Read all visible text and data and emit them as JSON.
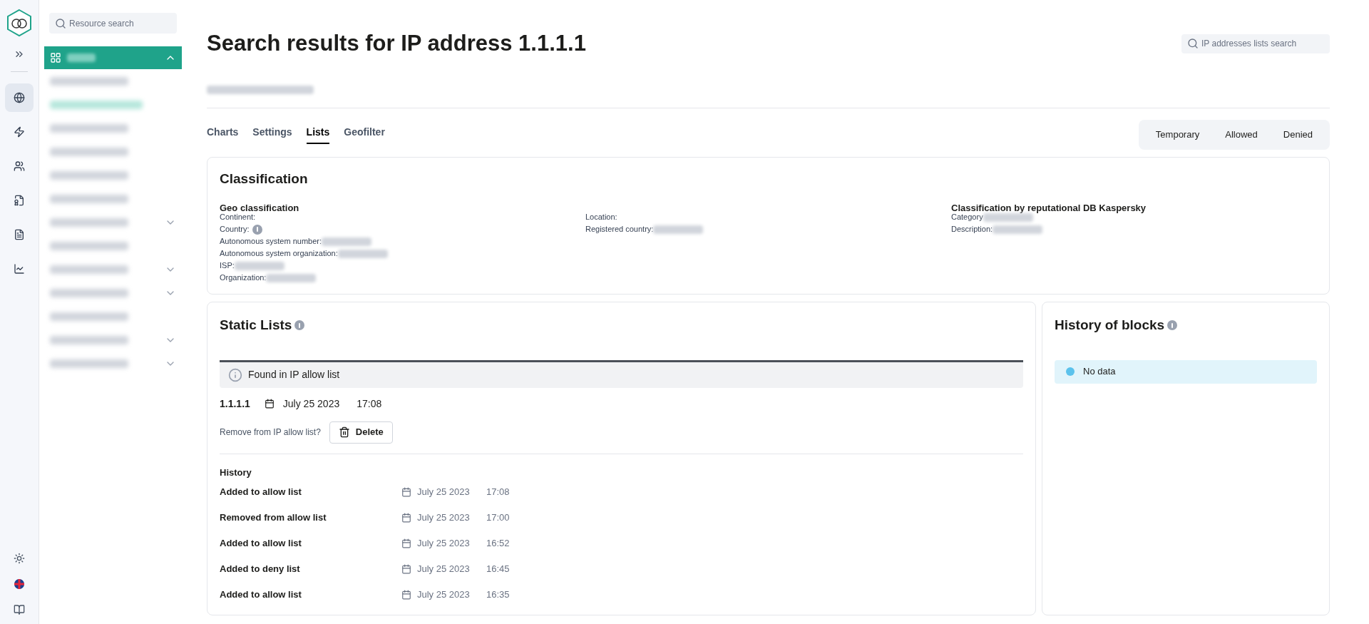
{
  "rail": {
    "items": [
      {
        "kind": "globe",
        "selected": true
      },
      {
        "kind": "zap",
        "selected": false
      },
      {
        "kind": "users",
        "selected": false
      },
      {
        "kind": "award",
        "selected": false
      },
      {
        "kind": "info",
        "selected": false
      },
      {
        "kind": "chart",
        "selected": false
      }
    ]
  },
  "sidebar": {
    "search": {
      "placeholder": "Resource search"
    },
    "items": [
      {
        "kind": "link",
        "selected": false
      },
      {
        "kind": "link",
        "selected": true
      },
      {
        "kind": "link",
        "selected": false
      },
      {
        "kind": "link",
        "selected": false
      },
      {
        "kind": "link",
        "selected": false
      },
      {
        "kind": "link",
        "selected": false
      },
      {
        "kind": "group",
        "selected": false
      },
      {
        "kind": "link",
        "selected": false
      },
      {
        "kind": "group",
        "selected": false
      },
      {
        "kind": "group",
        "selected": false
      },
      {
        "kind": "link",
        "selected": false
      },
      {
        "kind": "group",
        "selected": false
      },
      {
        "kind": "group",
        "selected": false
      }
    ]
  },
  "page": {
    "title": "Search results for IP address 1.1.1.1",
    "search": {
      "placeholder": "IP addresses lists search"
    }
  },
  "tabs": [
    {
      "label": "Charts",
      "selected": false
    },
    {
      "label": "Settings",
      "selected": false
    },
    {
      "label": "Lists",
      "selected": true
    },
    {
      "label": "Geofilter",
      "selected": false
    }
  ],
  "filters": [
    "Temporary",
    "Allowed",
    "Denied"
  ],
  "classification": {
    "title": "Classification",
    "columns": [
      {
        "heading": "Geo classification",
        "fields": [
          {
            "label": "Continent:",
            "redacted": false
          },
          {
            "label": "Country:",
            "info": true,
            "redacted": false
          },
          {
            "label": "Autonomous system number:",
            "redacted": true
          },
          {
            "label": "Autonomous system organization:",
            "redacted": true
          },
          {
            "label": "ISP:",
            "redacted": true
          },
          {
            "label": "Organization:",
            "redacted": true
          }
        ]
      },
      {
        "fields": [
          {
            "label": "Location:",
            "redacted": false
          },
          {
            "label": "Registered country:",
            "redacted": true
          }
        ]
      },
      {
        "heading": "Classification by reputational DB Kaspersky",
        "fields": [
          {
            "label": "Category",
            "redacted": true
          },
          {
            "label": "Description:",
            "redacted": true
          }
        ]
      }
    ]
  },
  "static_lists": {
    "title": "Static Lists",
    "notice": "Found in IP allow list",
    "entry": {
      "ip": "1.1.1.1",
      "date": "July 25 2023",
      "time": "17:08"
    },
    "remove_prompt": "Remove from IP allow list?",
    "delete_button": "Delete",
    "history_title": "History",
    "history": [
      {
        "action": "Added to allow list",
        "date": "July 25 2023",
        "time": "17:08"
      },
      {
        "action": "Removed from allow list",
        "date": "July 25 2023",
        "time": "17:00"
      },
      {
        "action": "Added to allow list",
        "date": "July 25 2023",
        "time": "16:52"
      },
      {
        "action": "Added to deny list",
        "date": "July 25 2023",
        "time": "16:45"
      },
      {
        "action": "Added to allow list",
        "date": "July 25 2023",
        "time": "16:35"
      }
    ]
  },
  "history_of_blocks": {
    "title": "History of blocks",
    "empty_message": "No data"
  }
}
